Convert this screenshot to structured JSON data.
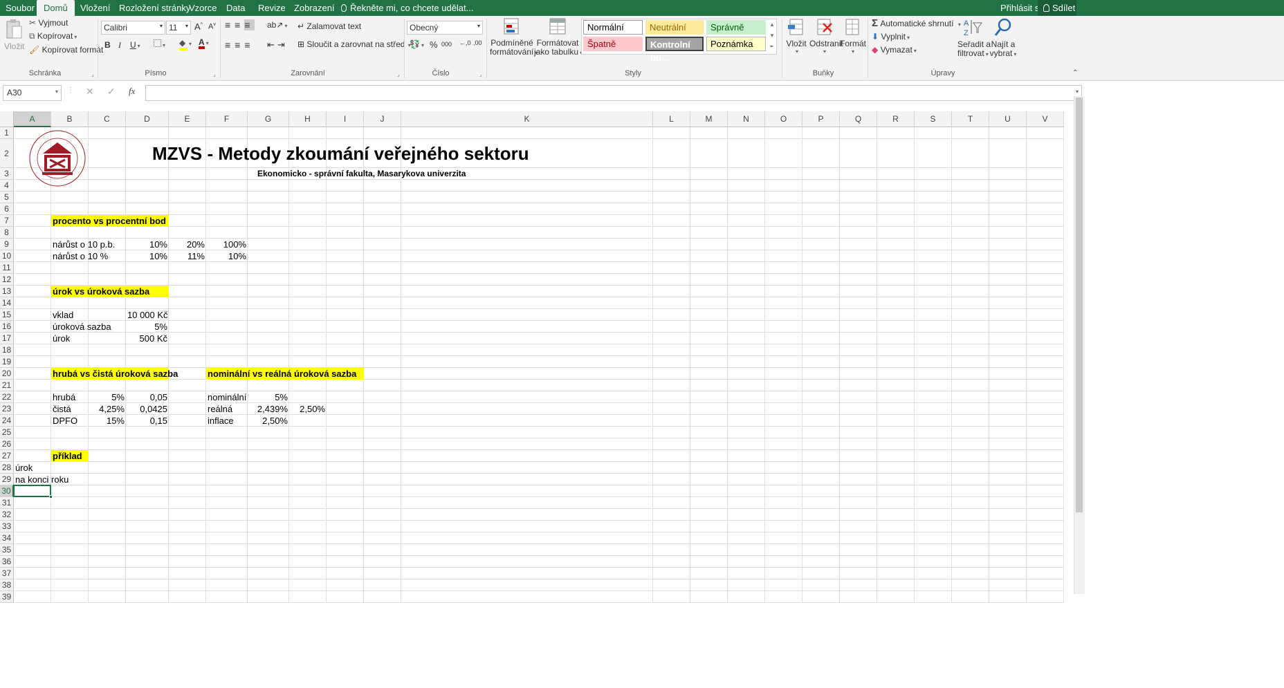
{
  "tabs": {
    "file": "Soubor",
    "home": "Domů",
    "insert": "Vložení",
    "layout": "Rozložení stránky",
    "formulas": "Vzorce",
    "data": "Data",
    "review": "Revize",
    "view": "Zobrazení",
    "tell": "Řekněte mi, co chcete udělat...",
    "signin": "Přihlásit se",
    "share": "Sdílet"
  },
  "ribbon": {
    "clipboard": {
      "paste": "Vložit",
      "cut": "Vyjmout",
      "copy": "Kopírovat",
      "format_painter": "Kopírovat formát",
      "group": "Schránka"
    },
    "font": {
      "name": "Calibri",
      "size": "11",
      "group": "Písmo"
    },
    "alignment": {
      "wrap": "Zalamovat text",
      "merge": "Sloučit a zarovnat na střed",
      "group": "Zarovnání"
    },
    "number": {
      "format": "Obecný",
      "group": "Číslo"
    },
    "styles": {
      "conditional_l1": "Podmíněné",
      "conditional_l2": "formátování",
      "table_l1": "Formátovat",
      "table_l2": "jako tabulku",
      "normal": "Normální",
      "neutral": "Neutrální",
      "good": "Správně",
      "bad": "Špatně",
      "check": "Kontrolní bu...",
      "note": "Poznámka",
      "group": "Styly"
    },
    "cells": {
      "insert": "Vložit",
      "delete": "Odstranit",
      "format": "Formát",
      "group": "Buňky"
    },
    "editing": {
      "autosum": "Automatické shrnutí",
      "fill": "Vyplnit",
      "clear": "Vymazat",
      "sort_l1": "Seřadit a",
      "sort_l2": "filtrovat",
      "find_l1": "Najít a",
      "find_l2": "vybrat",
      "group": "Úpravy"
    }
  },
  "formula_bar": {
    "name_box": "A30",
    "fx": "fx",
    "content": ""
  },
  "columns": [
    "A",
    "B",
    "C",
    "D",
    "E",
    "F",
    "G",
    "H",
    "I",
    "J",
    "K",
    "L",
    "M",
    "N",
    "O",
    "P",
    "Q",
    "R",
    "S",
    "T",
    "U",
    "V"
  ],
  "rows": [
    "1",
    "2",
    "3",
    "4",
    "5",
    "6",
    "7",
    "8",
    "9",
    "10",
    "11",
    "12",
    "13",
    "14",
    "15",
    "16",
    "17",
    "18",
    "19",
    "20",
    "21",
    "22",
    "23",
    "24",
    "25",
    "26",
    "27",
    "28",
    "29",
    "30",
    "31",
    "32",
    "33",
    "34",
    "35",
    "36",
    "37",
    "38",
    "39"
  ],
  "sheet": {
    "logo_text": "UNIVERSITAS MASARYKIANA BRUNENSIS · FACULTAS RERUM OECONOMICARUM",
    "title": "MZVS - Metody zkoumání veřejného sektoru",
    "subtitle": "Ekonomicko - správní fakulta, Masarykova univerzita",
    "h_percent": "procento vs procentní bod",
    "r9_label": "nárůst o  10 p.b.",
    "r9_d": "10%",
    "r9_e": "20%",
    "r9_f": "100%",
    "r10_label": "nárůst  o  10 %",
    "r10_d": "10%",
    "r10_e": "11%",
    "r10_f": "10%",
    "h_interest": "úrok vs úroková sazba",
    "r15_label": "vklad",
    "r15_d": "10 000 Kč",
    "r16_label": "úroková sazba",
    "r16_d": "5%",
    "r17_label": "úrok",
    "r17_d": "500 Kč",
    "h_gross": "hrubá vs čistá úroková sazba",
    "h_nominal": "nominální vs reálná úroková sazba",
    "r22_label": "hrubá",
    "r22_c": "5%",
    "r22_d": "0,05",
    "r22_f": "nominální",
    "r22_g": "5%",
    "r23_label": "čistá",
    "r23_c": "4,25%",
    "r23_d": "0,0425",
    "r23_f": "reálná",
    "r23_g": "2,439%",
    "r23_h": "2,50%",
    "r24_label": "DPFO",
    "r24_c": "15%",
    "r24_d": "0,15",
    "r24_f": "inflace",
    "r24_g": "2,50%",
    "h_example": "příklad",
    "r28": "úrok",
    "r29": "na konci roku"
  },
  "colors": {
    "excel_green": "#217346",
    "highlight_yellow": "#ffff00",
    "logo_red": "#a01c25"
  }
}
